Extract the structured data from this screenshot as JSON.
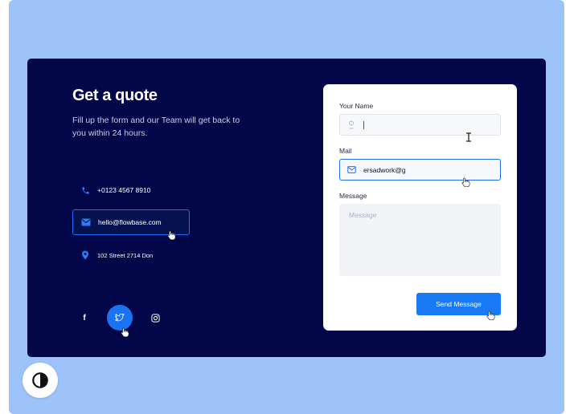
{
  "hero": {
    "title": "Get a quote",
    "subtitle": "Fill up the form and our Team will get back to you within 24 hours."
  },
  "contacts": {
    "phone": "+0123 4567 8910",
    "email": "hello@flowbase.com",
    "address": "102 Street 2714 Don"
  },
  "social": [
    "facebook-icon",
    "twitter-icon",
    "instagram-icon"
  ],
  "form": {
    "name_label": "Your Name",
    "name_value": "",
    "mail_label": "Mail",
    "mail_value": "ersadwork@g",
    "message_label": "Message",
    "message_placeholder": "Message",
    "send_label": "Send Message"
  },
  "colors": {
    "backdrop": "#9dc3fa",
    "card": "#03074a",
    "accent": "#1a7af5"
  }
}
